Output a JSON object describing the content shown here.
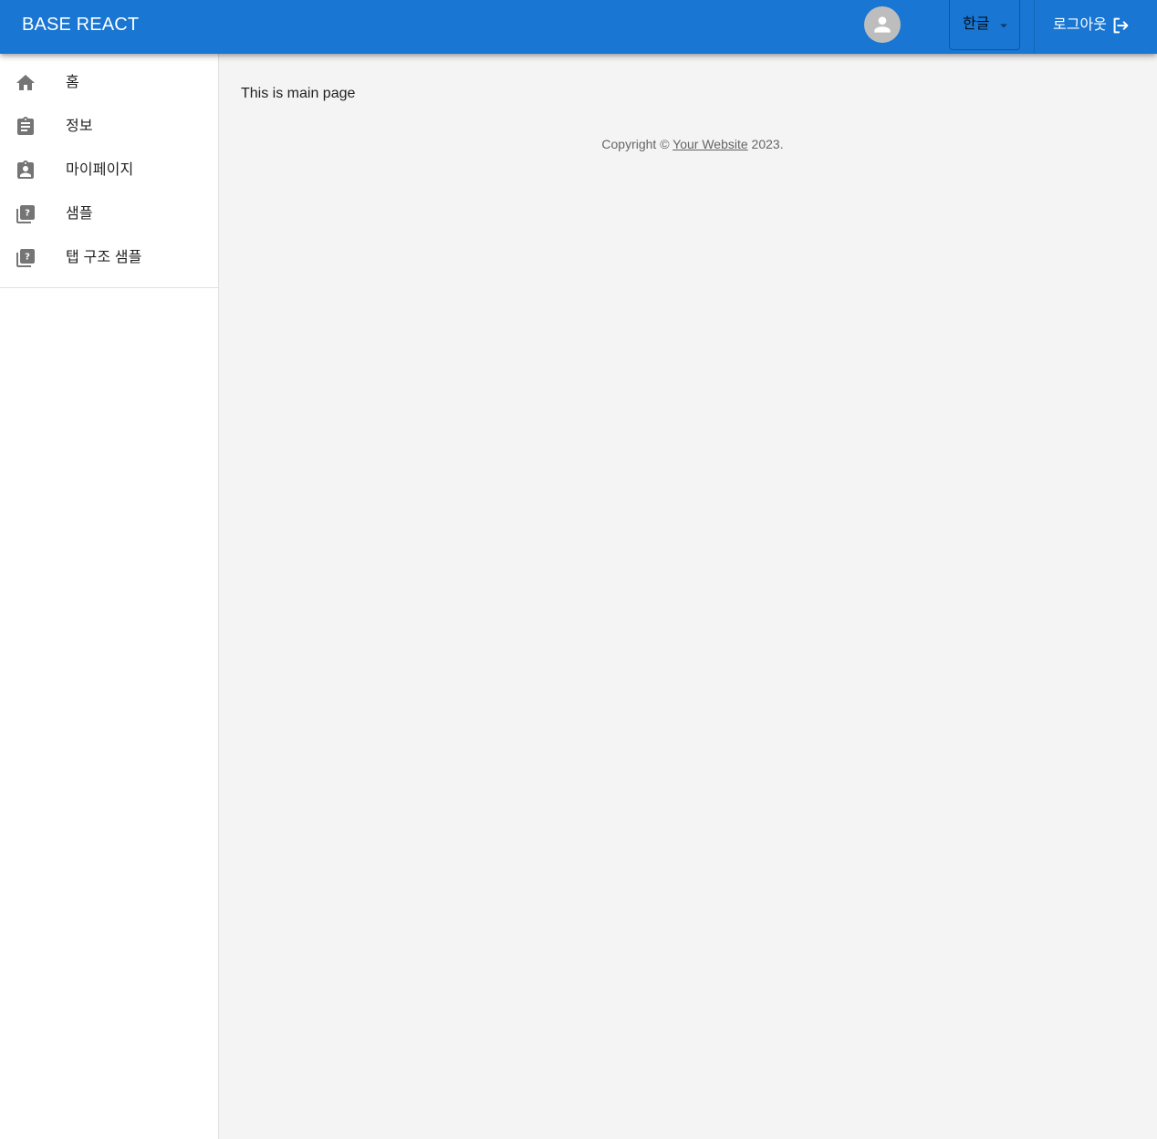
{
  "header": {
    "title": "BASE REACT",
    "language": {
      "selected": "한글"
    },
    "logout_label": "로그아웃"
  },
  "sidebar": {
    "items": [
      {
        "label": "홈",
        "icon": "home-icon"
      },
      {
        "label": "정보",
        "icon": "assignment-icon"
      },
      {
        "label": "마이페이지",
        "icon": "assignment-ind-icon"
      },
      {
        "label": "샘플",
        "icon": "library-question-icon"
      },
      {
        "label": "탭 구조 샘플",
        "icon": "library-question-icon"
      }
    ]
  },
  "main": {
    "text": "This is main page"
  },
  "footer": {
    "prefix": "Copyright ©",
    "link_text": "Your Website",
    "suffix": "2023."
  },
  "colors": {
    "appbar": "#1976d2",
    "icon": "#757575",
    "avatar": "#bdbdbd",
    "background": "#f4f4f4"
  }
}
